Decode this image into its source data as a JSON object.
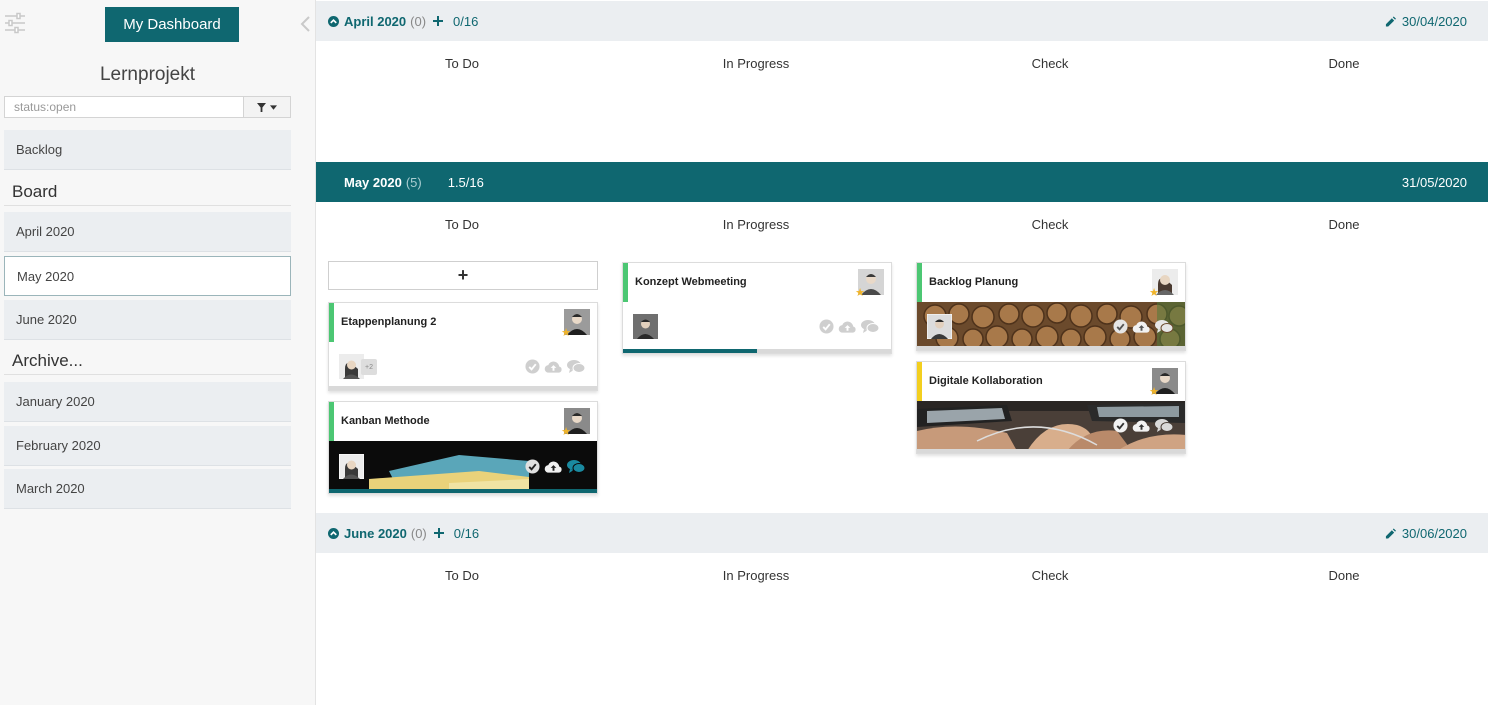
{
  "sidebar": {
    "dashboard_label": "My Dashboard",
    "project_title": "Lernprojekt",
    "filter_value": "status:open",
    "backlog_label": "Backlog",
    "board_heading": "Board",
    "board_items": [
      {
        "label": "April 2020"
      },
      {
        "label": "May 2020"
      },
      {
        "label": "June 2020"
      }
    ],
    "active_board": "May 2020",
    "archive_heading": "Archive...",
    "archive_items": [
      {
        "label": "January 2020"
      },
      {
        "label": "February 2020"
      },
      {
        "label": "March 2020"
      }
    ]
  },
  "columns": [
    "To Do",
    "In Progress",
    "Check",
    "Done"
  ],
  "sprints": [
    {
      "name": "April 2020",
      "count": "(0)",
      "progress": "0/16",
      "date": "30/04/2020",
      "expanded": false
    },
    {
      "name": "May 2020",
      "count": "(5)",
      "progress": "1.5/16",
      "date": "31/05/2020",
      "expanded": true
    },
    {
      "name": "June 2020",
      "count": "(0)",
      "progress": "0/16",
      "date": "30/06/2020",
      "expanded": false
    }
  ],
  "add_card_symbol": "+",
  "plus_count": "+2",
  "cards": [
    {
      "title": "Etappenplanung 2",
      "column": "To Do",
      "stripe_color": "#4cc773",
      "image": "none"
    },
    {
      "title": "Kanban Methode",
      "column": "To Do",
      "stripe_color": "#4cc773",
      "image": "books-on-dark"
    },
    {
      "title": "Konzept Webmeeting",
      "column": "In Progress",
      "stripe_color": "#4cc773",
      "image": "none",
      "progress": 0.5
    },
    {
      "title": "Backlog Planung",
      "column": "Check",
      "stripe_color": "#4cc773",
      "image": "stacked-logs"
    },
    {
      "title": "Digitale Kollaboration",
      "column": "Check",
      "stripe_color": "#f3cf1f",
      "image": "laptops-and-fists"
    }
  ],
  "colors": {
    "accent": "#0f6770",
    "bar": "#ebeef1",
    "star": "#f0b429"
  }
}
